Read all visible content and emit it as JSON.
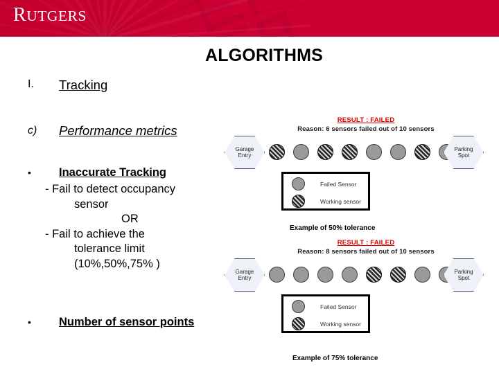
{
  "banner": {
    "logo_text": "RUTGERS",
    "brand_color": "#cc0033"
  },
  "slide": {
    "title": "ALGORITHMS"
  },
  "outline": [
    {
      "marker": "I.",
      "label": "Tracking"
    },
    {
      "marker": "c)",
      "label": "Performance metrics"
    },
    {
      "marker": "•",
      "label": "Inaccurate Tracking"
    },
    {
      "marker": "•",
      "label": "Number of sensor points"
    }
  ],
  "sub_lines": [
    "-  Fail to detect occupancy",
    "sensor",
    "OR",
    "-  Fail to achieve the",
    "tolerance limit",
    "(10%,50%,75% )"
  ],
  "legend": {
    "failed_label": "Failed Sensor",
    "working_label": "Working sensor",
    "failed_color": "#9a9a9a",
    "working_color": "#262626"
  },
  "nodes": {
    "garage_line1": "Garage",
    "garage_line2": "Entry",
    "parking_line1": "Parking",
    "parking_line2": "Spot"
  },
  "diagram_top": {
    "result": "RESULT : FAILED",
    "reason": "Reason: 6 sensors failed out of 10 sensors",
    "result_color": "#e00000",
    "sensors": [
      "working",
      "failed",
      "working",
      "working",
      "failed",
      "failed",
      "working",
      "failed",
      "failed"
    ],
    "caption": "Example of 50% tolerance"
  },
  "diagram_bottom": {
    "result": "RESULT : FAILED",
    "reason": "Reason: 8 sensors failed out of 10 sensors",
    "result_color": "#e00000",
    "sensors": [
      "failed",
      "failed",
      "failed",
      "failed",
      "working",
      "working",
      "failed",
      "failed",
      "failed"
    ],
    "caption": "Example of 75% tolerance"
  }
}
